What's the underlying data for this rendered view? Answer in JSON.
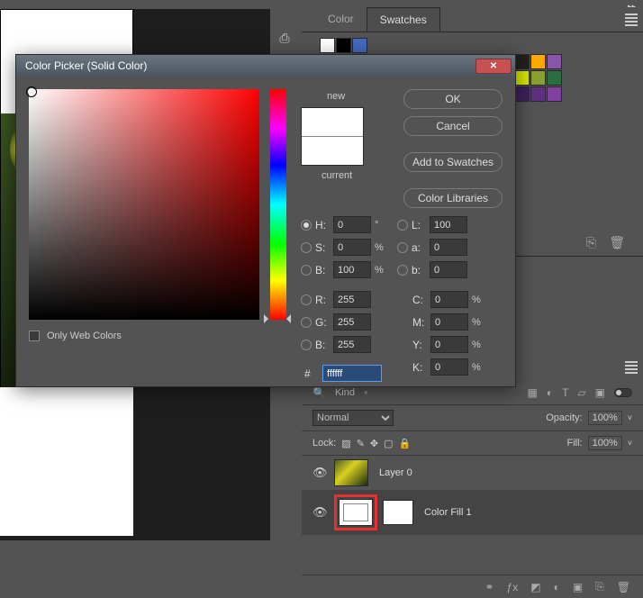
{
  "top_arrow": "▸▸",
  "tabs": {
    "color": "Color",
    "swatches": "Swatches"
  },
  "dialog": {
    "title": "Color Picker (Solid Color)",
    "close": "✕",
    "new_label": "new",
    "current_label": "current",
    "ok": "OK",
    "cancel": "Cancel",
    "add_swatch": "Add to Swatches",
    "color_lib": "Color Libraries",
    "only_web": "Only Web Colors",
    "fields": {
      "H": {
        "label": "H:",
        "value": "0",
        "unit": "°"
      },
      "S": {
        "label": "S:",
        "value": "0",
        "unit": "%"
      },
      "Bhsb": {
        "label": "B:",
        "value": "100",
        "unit": "%"
      },
      "R": {
        "label": "R:",
        "value": "255",
        "unit": ""
      },
      "G": {
        "label": "G:",
        "value": "255",
        "unit": ""
      },
      "Brgb": {
        "label": "B:",
        "value": "255",
        "unit": ""
      },
      "L": {
        "label": "L:",
        "value": "100",
        "unit": ""
      },
      "a": {
        "label": "a:",
        "value": "0",
        "unit": ""
      },
      "b": {
        "label": "b:",
        "value": "0",
        "unit": ""
      },
      "C": {
        "label": "C:",
        "value": "0",
        "unit": "%"
      },
      "M": {
        "label": "M:",
        "value": "0",
        "unit": "%"
      },
      "Y": {
        "label": "Y:",
        "value": "0",
        "unit": "%"
      },
      "K": {
        "label": "K:",
        "value": "0",
        "unit": "%"
      },
      "hex": {
        "label": "#",
        "value": "ffffff"
      }
    }
  },
  "swatch_colors": [
    "#ffffff",
    "#000000",
    "#456abd",
    "#535353",
    "#535353",
    "#535353",
    "#535353",
    "#535353",
    "#535353",
    "#535353",
    "#535353",
    "#535353",
    "#535353",
    "#535353",
    "#535353",
    "#ff0000",
    "#ffff00",
    "#00ff00",
    "#00ffff",
    "#0000ff",
    "#ff00ff",
    "#e0e0e0",
    "#c0c0c0",
    "#a0a0a0",
    "#808080",
    "#606060",
    "#404040",
    "#202020",
    "#ffaa00",
    "#8855aa",
    "#e0c080",
    "#e0e0a0",
    "#a0e0a0",
    "#a0e0e0",
    "#a0a0e0",
    "#e0a0e0",
    "#fff0c0",
    "#ffe080",
    "#ffc040",
    "#ff8000",
    "#c06000",
    "#804000",
    "#d8e800",
    "#8aa030",
    "#2a6e3f",
    "#008040",
    "#00a060",
    "#00c080",
    "#00e0a0",
    "#00ffc0",
    "#40ffe0",
    "#004080",
    "#0060a0",
    "#0080c0",
    "#00a0e0",
    "#00c0ff",
    "#40e0ff",
    "#402060",
    "#603080",
    "#8040a0",
    "#400020",
    "#600030",
    "#800040",
    "#a00050",
    "#c00060",
    "#e00070",
    "#e0d0b0",
    "#604830",
    "#302010",
    "#e0c080",
    "#8a0050",
    "#4a6e8a",
    "#535353",
    "#535353",
    "#535353"
  ],
  "layers": {
    "kind": "Kind",
    "blend": "Normal",
    "opacity_label": "Opacity:",
    "opacity_val": "100%",
    "lock_label": "Lock:",
    "fill_label": "Fill:",
    "fill_val": "100%",
    "layer0": "Layer 0",
    "colorfill": "Color Fill 1"
  }
}
